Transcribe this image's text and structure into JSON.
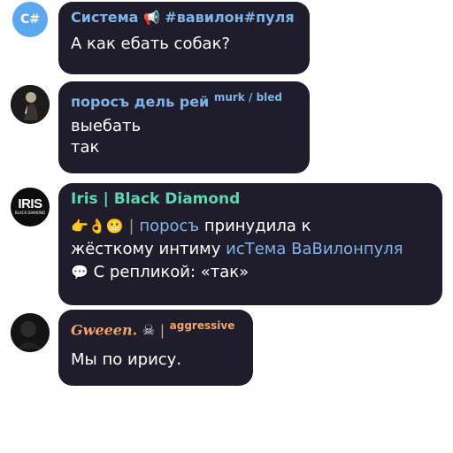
{
  "messages": [
    {
      "sender": "Система",
      "sender_color": "#7fb3e8",
      "sender_suffix": "#вавилон#пуля",
      "avatar_text": "C#",
      "avatar_color": "#5aa9ee",
      "text": "А как ебать собак?"
    },
    {
      "sender": "поросъ дель рей",
      "sender_color": "#7fb3e8",
      "tag_left": "murk",
      "tag_sep": "/",
      "tag_right": "bled",
      "text_line1": "выебать",
      "text_line2": "так"
    },
    {
      "sender": "Iris | Black Diamond",
      "sender_color": "#5ed6b0",
      "avatar_text": "IRIS",
      "avatar_subtext": "BLACK DIAMOND",
      "emoji_row": "👉👌😬",
      "sep": "|",
      "line1_name": "поросъ",
      "line1_rest": " принудила к",
      "line2_main": "жёсткому интиму ",
      "line2_name": "исТема ВаВилонпуля",
      "line3_icon": "speech-bubble-icon",
      "line3": " С репликой: «так»",
      "name_color": "#7fb3e8"
    },
    {
      "sender": "Gweeen.",
      "sender_color": "#f0a46a",
      "skull": "☠",
      "sep": "|",
      "tag": "aggressive",
      "text": "Мы по ирису."
    }
  ]
}
